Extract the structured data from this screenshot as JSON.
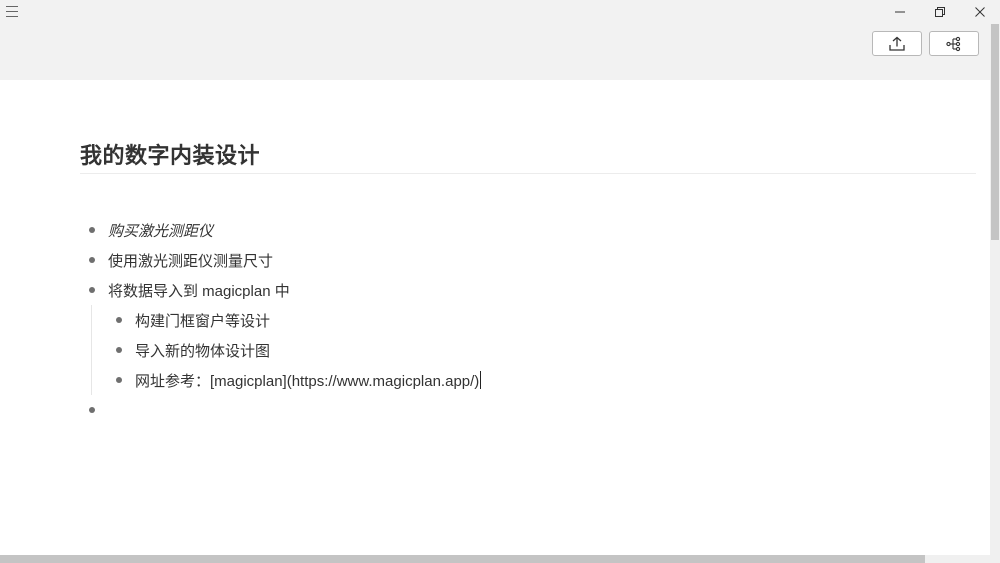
{
  "titlebar": {
    "menu_icon": "hamburger-menu-icon",
    "minimize_icon": "minimize-icon",
    "maximize_icon": "restore-icon",
    "close_icon": "close-icon"
  },
  "toolbar": {
    "export_icon": "export-upload-icon",
    "mindmap_icon": "mind-map-icon"
  },
  "document": {
    "title": "我的数字内装设计",
    "nodes": [
      {
        "text": "购买激光测距仪",
        "italic": true,
        "level": 1
      },
      {
        "text": "使用激光测距仪测量尺寸",
        "italic": false,
        "level": 1
      },
      {
        "text": "将数据导入到 magicplan 中",
        "italic": false,
        "level": 1
      },
      {
        "text": "构建门框窗户等设计",
        "italic": false,
        "level": 2
      },
      {
        "text": "导入新的物体设计图",
        "italic": false,
        "level": 2
      },
      {
        "text": "网址参考：[magicplan](https://www.magicplan.app/)",
        "italic": false,
        "level": 2
      },
      {
        "text": "",
        "italic": false,
        "level": 1
      }
    ]
  },
  "colors": {
    "chrome_background": "#f2f2f2",
    "text": "#333333",
    "bullet": "#6f6f6f"
  }
}
